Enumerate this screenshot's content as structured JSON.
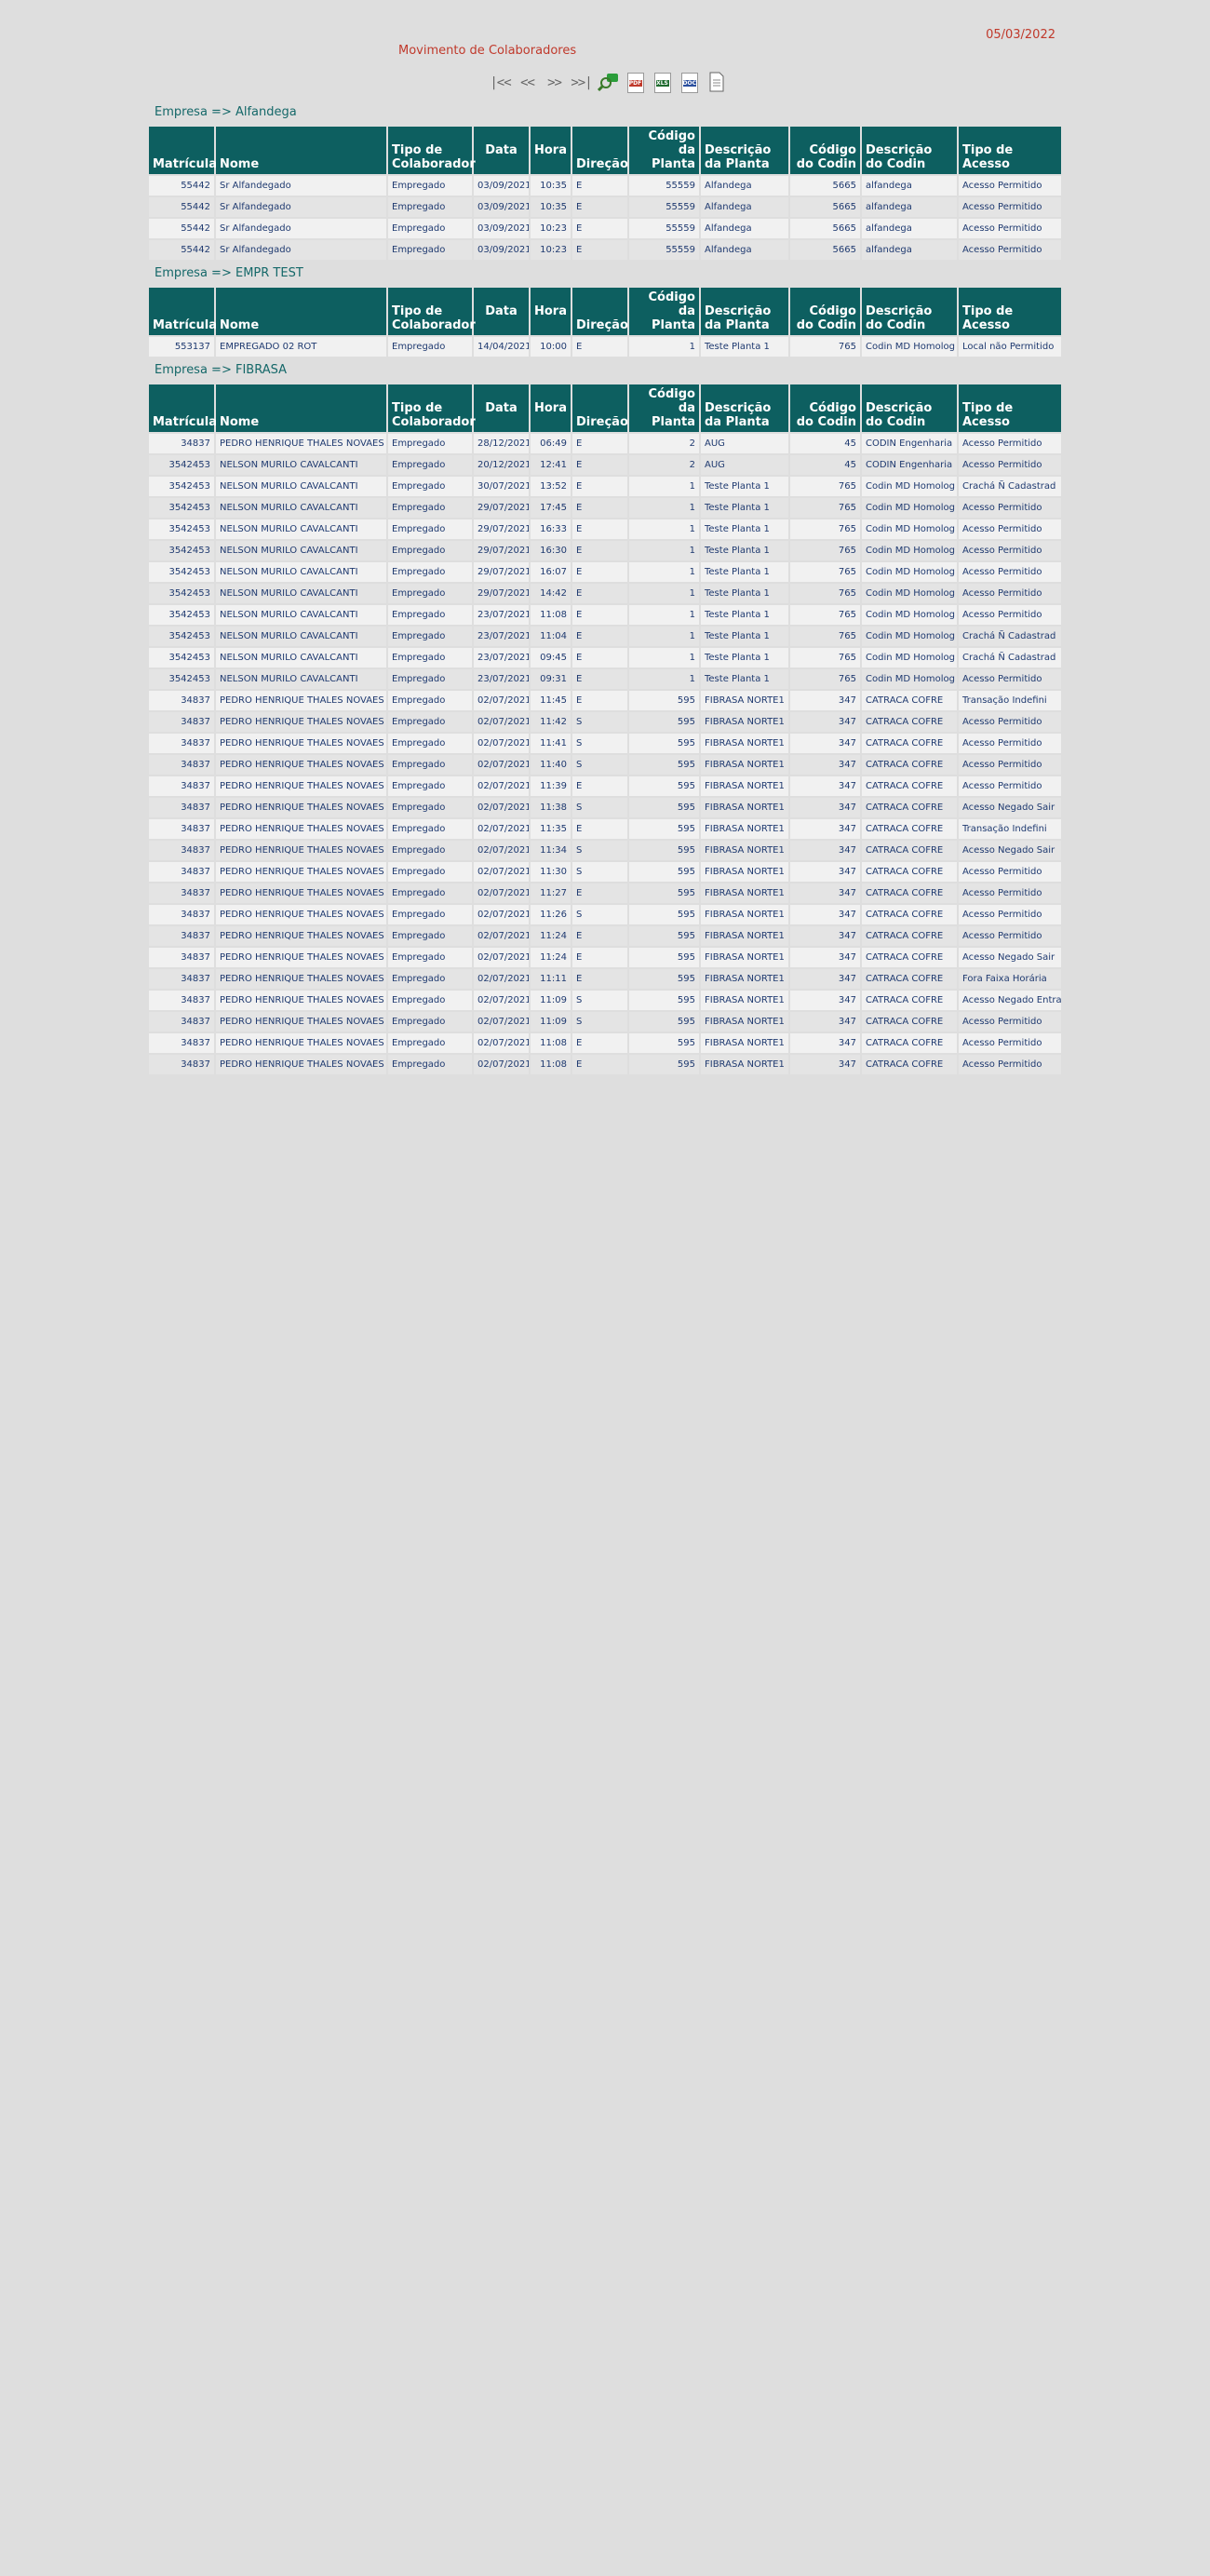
{
  "header": {
    "date": "05/03/2022",
    "title": "Movimento de Colaboradores"
  },
  "toolbar": {
    "first": "|<<",
    "prev": "<<",
    "next": ">>",
    "last": ">>|",
    "pdf_label": "PDF",
    "xls_label": "XLS",
    "doc_label": "DOC"
  },
  "columns": [
    "Matrícula",
    "Nome",
    "Tipo de Colaborador",
    "Data",
    "Hora",
    "Direção",
    "Código da Planta",
    "Descrição da Planta",
    "Código do Codin",
    "Descrição do Codin",
    "Tipo de Acesso"
  ],
  "groups": [
    {
      "company": "Empresa => Alfandega",
      "rows": [
        [
          "55442",
          "Sr Alfandegado",
          "Empregado",
          "03/09/2021",
          "10:35",
          "E",
          "55559",
          "Alfandega",
          "5665",
          "alfandega",
          "Acesso Permitido"
        ],
        [
          "55442",
          "Sr Alfandegado",
          "Empregado",
          "03/09/2021",
          "10:35",
          "E",
          "55559",
          "Alfandega",
          "5665",
          "alfandega",
          "Acesso Permitido"
        ],
        [
          "55442",
          "Sr Alfandegado",
          "Empregado",
          "03/09/2021",
          "10:23",
          "E",
          "55559",
          "Alfandega",
          "5665",
          "alfandega",
          "Acesso Permitido"
        ],
        [
          "55442",
          "Sr Alfandegado",
          "Empregado",
          "03/09/2021",
          "10:23",
          "E",
          "55559",
          "Alfandega",
          "5665",
          "alfandega",
          "Acesso Permitido"
        ]
      ]
    },
    {
      "company": "Empresa => EMPR TEST",
      "rows": [
        [
          "553137",
          "EMPREGADO 02 ROT",
          "Empregado",
          "14/04/2021",
          "10:00",
          "E",
          "1",
          "Teste Planta 1",
          "765",
          "Codin MD Homolog",
          "Local não Permitido"
        ]
      ]
    },
    {
      "company": "Empresa => FIBRASA",
      "rows": [
        [
          "34837",
          "PEDRO HENRIQUE THALES NOVAES",
          "Empregado",
          "28/12/2021",
          "06:49",
          "E",
          "2",
          "AUG",
          "45",
          "CODIN Engenharia",
          "Acesso Permitido"
        ],
        [
          "3542453",
          "NELSON MURILO CAVALCANTI",
          "Empregado",
          "20/12/2021",
          "12:41",
          "E",
          "2",
          "AUG",
          "45",
          "CODIN Engenharia",
          "Acesso Permitido"
        ],
        [
          "3542453",
          "NELSON MURILO CAVALCANTI",
          "Empregado",
          "30/07/2021",
          "13:52",
          "E",
          "1",
          "Teste Planta 1",
          "765",
          "Codin MD Homolog",
          "Crachá  Ñ Cadastrad"
        ],
        [
          "3542453",
          "NELSON MURILO CAVALCANTI",
          "Empregado",
          "29/07/2021",
          "17:45",
          "E",
          "1",
          "Teste Planta 1",
          "765",
          "Codin MD Homolog",
          "Acesso Permitido"
        ],
        [
          "3542453",
          "NELSON MURILO CAVALCANTI",
          "Empregado",
          "29/07/2021",
          "16:33",
          "E",
          "1",
          "Teste Planta 1",
          "765",
          "Codin MD Homolog",
          "Acesso Permitido"
        ],
        [
          "3542453",
          "NELSON MURILO CAVALCANTI",
          "Empregado",
          "29/07/2021",
          "16:30",
          "E",
          "1",
          "Teste Planta 1",
          "765",
          "Codin MD Homolog",
          "Acesso Permitido"
        ],
        [
          "3542453",
          "NELSON MURILO CAVALCANTI",
          "Empregado",
          "29/07/2021",
          "16:07",
          "E",
          "1",
          "Teste Planta 1",
          "765",
          "Codin MD Homolog",
          "Acesso Permitido"
        ],
        [
          "3542453",
          "NELSON MURILO CAVALCANTI",
          "Empregado",
          "29/07/2021",
          "14:42",
          "E",
          "1",
          "Teste Planta 1",
          "765",
          "Codin MD Homolog",
          "Acesso Permitido"
        ],
        [
          "3542453",
          "NELSON MURILO CAVALCANTI",
          "Empregado",
          "23/07/2021",
          "11:08",
          "E",
          "1",
          "Teste Planta 1",
          "765",
          "Codin MD Homolog",
          "Acesso Permitido"
        ],
        [
          "3542453",
          "NELSON MURILO CAVALCANTI",
          "Empregado",
          "23/07/2021",
          "11:04",
          "E",
          "1",
          "Teste Planta 1",
          "765",
          "Codin MD Homolog",
          "Crachá  Ñ Cadastrad"
        ],
        [
          "3542453",
          "NELSON MURILO CAVALCANTI",
          "Empregado",
          "23/07/2021",
          "09:45",
          "E",
          "1",
          "Teste Planta 1",
          "765",
          "Codin MD Homolog",
          "Crachá  Ñ Cadastrad"
        ],
        [
          "3542453",
          "NELSON MURILO CAVALCANTI",
          "Empregado",
          "23/07/2021",
          "09:31",
          "E",
          "1",
          "Teste Planta 1",
          "765",
          "Codin MD Homolog",
          "Acesso Permitido"
        ],
        [
          "34837",
          "PEDRO HENRIQUE THALES NOVAES",
          "Empregado",
          "02/07/2021",
          "11:45",
          "E",
          "595",
          "FIBRASA NORTE1",
          "347",
          "CATRACA COFRE",
          "Transação Indefini"
        ],
        [
          "34837",
          "PEDRO HENRIQUE THALES NOVAES",
          "Empregado",
          "02/07/2021",
          "11:42",
          "S",
          "595",
          "FIBRASA NORTE1",
          "347",
          "CATRACA COFRE",
          "Acesso Permitido"
        ],
        [
          "34837",
          "PEDRO HENRIQUE THALES NOVAES",
          "Empregado",
          "02/07/2021",
          "11:41",
          "S",
          "595",
          "FIBRASA NORTE1",
          "347",
          "CATRACA COFRE",
          "Acesso Permitido"
        ],
        [
          "34837",
          "PEDRO HENRIQUE THALES NOVAES",
          "Empregado",
          "02/07/2021",
          "11:40",
          "S",
          "595",
          "FIBRASA NORTE1",
          "347",
          "CATRACA COFRE",
          "Acesso Permitido"
        ],
        [
          "34837",
          "PEDRO HENRIQUE THALES NOVAES",
          "Empregado",
          "02/07/2021",
          "11:39",
          "E",
          "595",
          "FIBRASA NORTE1",
          "347",
          "CATRACA COFRE",
          "Acesso Permitido"
        ],
        [
          "34837",
          "PEDRO HENRIQUE THALES NOVAES",
          "Empregado",
          "02/07/2021",
          "11:38",
          "S",
          "595",
          "FIBRASA NORTE1",
          "347",
          "CATRACA COFRE",
          "Acesso Negado Sair"
        ],
        [
          "34837",
          "PEDRO HENRIQUE THALES NOVAES",
          "Empregado",
          "02/07/2021",
          "11:35",
          "E",
          "595",
          "FIBRASA NORTE1",
          "347",
          "CATRACA COFRE",
          "Transação Indefini"
        ],
        [
          "34837",
          "PEDRO HENRIQUE THALES NOVAES",
          "Empregado",
          "02/07/2021",
          "11:34",
          "S",
          "595",
          "FIBRASA NORTE1",
          "347",
          "CATRACA COFRE",
          "Acesso Negado Sair"
        ],
        [
          "34837",
          "PEDRO HENRIQUE THALES NOVAES",
          "Empregado",
          "02/07/2021",
          "11:30",
          "S",
          "595",
          "FIBRASA NORTE1",
          "347",
          "CATRACA COFRE",
          "Acesso Permitido"
        ],
        [
          "34837",
          "PEDRO HENRIQUE THALES NOVAES",
          "Empregado",
          "02/07/2021",
          "11:27",
          "E",
          "595",
          "FIBRASA NORTE1",
          "347",
          "CATRACA COFRE",
          "Acesso Permitido"
        ],
        [
          "34837",
          "PEDRO HENRIQUE THALES NOVAES",
          "Empregado",
          "02/07/2021",
          "11:26",
          "S",
          "595",
          "FIBRASA NORTE1",
          "347",
          "CATRACA COFRE",
          "Acesso Permitido"
        ],
        [
          "34837",
          "PEDRO HENRIQUE THALES NOVAES",
          "Empregado",
          "02/07/2021",
          "11:24",
          "E",
          "595",
          "FIBRASA NORTE1",
          "347",
          "CATRACA COFRE",
          "Acesso Permitido"
        ],
        [
          "34837",
          "PEDRO HENRIQUE THALES NOVAES",
          "Empregado",
          "02/07/2021",
          "11:24",
          "E",
          "595",
          "FIBRASA NORTE1",
          "347",
          "CATRACA COFRE",
          "Acesso Negado Sair"
        ],
        [
          "34837",
          "PEDRO HENRIQUE THALES NOVAES",
          "Empregado",
          "02/07/2021",
          "11:11",
          "E",
          "595",
          "FIBRASA NORTE1",
          "347",
          "CATRACA COFRE",
          "Fora Faixa Horária"
        ],
        [
          "34837",
          "PEDRO HENRIQUE THALES NOVAES",
          "Empregado",
          "02/07/2021",
          "11:09",
          "S",
          "595",
          "FIBRASA NORTE1",
          "347",
          "CATRACA COFRE",
          "Acesso Negado Entrar"
        ],
        [
          "34837",
          "PEDRO HENRIQUE THALES NOVAES",
          "Empregado",
          "02/07/2021",
          "11:09",
          "S",
          "595",
          "FIBRASA NORTE1",
          "347",
          "CATRACA COFRE",
          "Acesso Permitido"
        ],
        [
          "34837",
          "PEDRO HENRIQUE THALES NOVAES",
          "Empregado",
          "02/07/2021",
          "11:08",
          "E",
          "595",
          "FIBRASA NORTE1",
          "347",
          "CATRACA COFRE",
          "Acesso Permitido"
        ],
        [
          "34837",
          "PEDRO HENRIQUE THALES NOVAES",
          "Empregado",
          "02/07/2021",
          "11:08",
          "E",
          "595",
          "FIBRASA NORTE1",
          "347",
          "CATRACA COFRE",
          "Acesso Permitido"
        ]
      ]
    }
  ]
}
